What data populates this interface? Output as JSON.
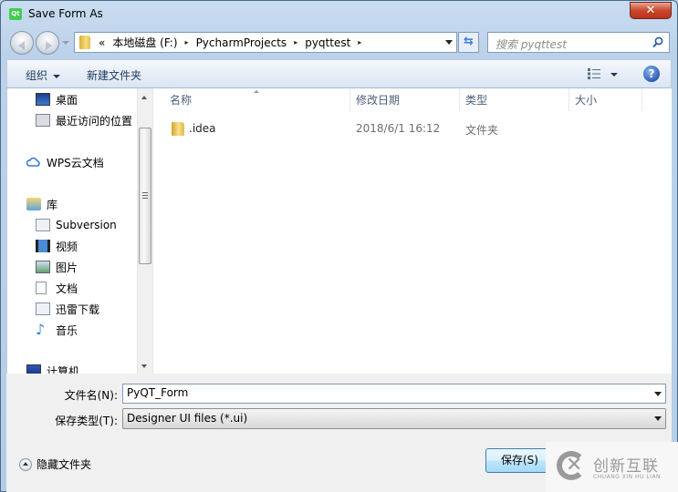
{
  "window": {
    "title": "Save Form As",
    "app_icon_label": "Qt",
    "close_label": "✕"
  },
  "navigation": {
    "address": {
      "overflow": "«",
      "crumbs": [
        "本地磁盘 (F:)",
        "PycharmProjects",
        "pyqttest"
      ],
      "separator": "▸"
    },
    "refresh_label": "⇆",
    "search": {
      "placeholder": "搜索 pyqttest"
    }
  },
  "toolbar": {
    "organize_label": "组织",
    "new_folder_label": "新建文件夹",
    "help_label": "?"
  },
  "sidebar": {
    "items": [
      {
        "label": "桌面",
        "icon": "desktop-icon"
      },
      {
        "label": "最近访问的位置",
        "icon": "recent-places-icon"
      },
      {
        "label": "WPS云文档",
        "icon": "cloud-icon"
      },
      {
        "label": "库",
        "icon": "library-icon"
      },
      {
        "label": "Subversion",
        "icon": "document-library-icon"
      },
      {
        "label": "视频",
        "icon": "video-icon"
      },
      {
        "label": "图片",
        "icon": "pictures-icon"
      },
      {
        "label": "文档",
        "icon": "documents-icon"
      },
      {
        "label": "迅雷下载",
        "icon": "download-library-icon"
      },
      {
        "label": "音乐",
        "icon": "music-icon"
      },
      {
        "label": "计算机",
        "icon": "computer-icon"
      }
    ]
  },
  "file_list": {
    "columns": [
      "名称",
      "修改日期",
      "类型",
      "大小"
    ],
    "rows": [
      {
        "name": ".idea",
        "modified": "2018/6/1 16:12",
        "type": "文件夹",
        "size": ""
      }
    ]
  },
  "form": {
    "filename_label": "文件名(N):",
    "filename_value": "PyQT_Form",
    "filetype_label": "保存类型(T):",
    "filetype_value": "Designer UI files (*.ui)",
    "hide_folders_label": "隐藏文件夹",
    "save_label": "保存(S)"
  },
  "watermark": {
    "text": "创新互联",
    "subtext": "CHUANG XIN HU LIAN"
  }
}
